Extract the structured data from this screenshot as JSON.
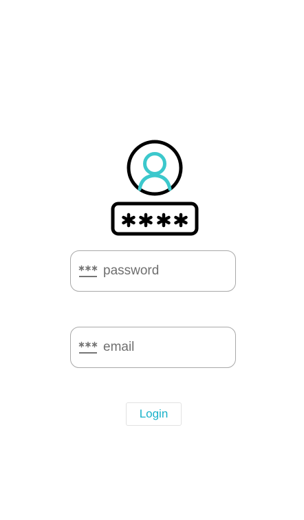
{
  "logo": {
    "icon": "user-password-icon",
    "colors": {
      "outline": "#000000",
      "user": "#3cc8cc"
    }
  },
  "form": {
    "password": {
      "placeholder": "password",
      "value": "",
      "icon": "password-stars-icon"
    },
    "email": {
      "placeholder": "email",
      "value": "",
      "icon": "password-stars-icon"
    }
  },
  "login_button": {
    "label": "Login"
  },
  "colors": {
    "accent": "#17b1c9",
    "field_border": "#a8a8a8",
    "placeholder": "#6f6f6f"
  }
}
